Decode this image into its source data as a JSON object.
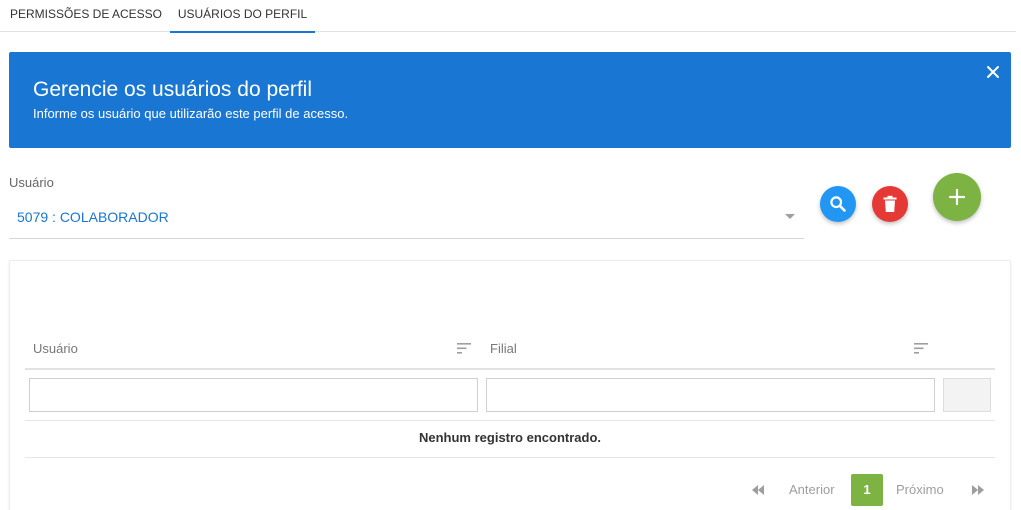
{
  "tabs": [
    {
      "label": "PERMISSÕES DE ACESSO"
    },
    {
      "label": "USUÁRIOS DO PERFIL",
      "active": true
    }
  ],
  "banner": {
    "title": "Gerencie os usuários do perfil",
    "subtitle": "Informe os usuário que utilizarão este perfil de acesso.",
    "color": "#1976d2",
    "close_icon": "close-icon"
  },
  "user_field": {
    "label": "Usuário",
    "value": "5079 : COLABORADOR"
  },
  "actions": {
    "search_icon": "search-icon",
    "delete_icon": "trash-icon",
    "add_icon": "plus-icon",
    "colors": {
      "search": "#2196f3",
      "delete": "#e53935",
      "add": "#7cb342"
    }
  },
  "table": {
    "columns": [
      "Usuário",
      "Filial"
    ],
    "empty_message": "Nenhum registro encontrado."
  },
  "pagination": {
    "previous": "Anterior",
    "next": "Próximo",
    "current_page": "1"
  }
}
